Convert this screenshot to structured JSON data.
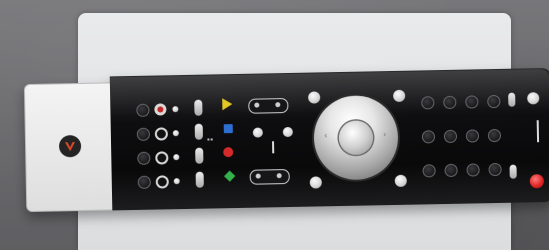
{
  "scene": {
    "subject": "",
    "background_color": "#6d6d70",
    "card_color": "#e4e5e7"
  },
  "remote": {
    "logo_mark": "",
    "colors": {
      "body": "#0b0b0c",
      "end_cap": "#ececec",
      "yellow": "#e3c825",
      "blue": "#2d6fd1",
      "red": "#d52a2a",
      "green": "#35b04a",
      "power": "#e02626"
    },
    "icons": [
      "logo-v-icon",
      "play-triangle-icon",
      "stop-square-icon",
      "record-circle-icon",
      "diamond-icon",
      "power-icon"
    ]
  }
}
